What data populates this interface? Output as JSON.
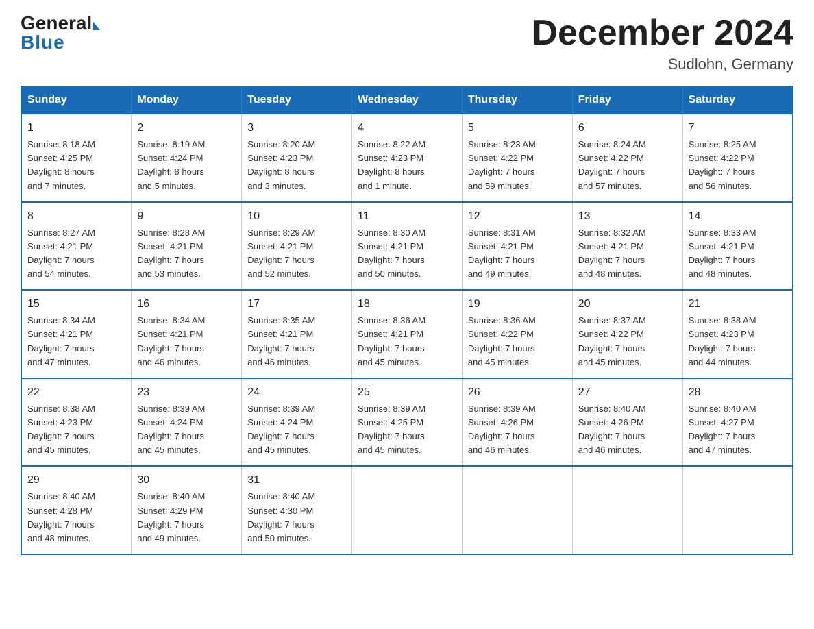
{
  "logo": {
    "general": "General",
    "blue": "Blue",
    "tagline": "Blue"
  },
  "title": "December 2024",
  "subtitle": "Sudlohn, Germany",
  "headers": [
    "Sunday",
    "Monday",
    "Tuesday",
    "Wednesday",
    "Thursday",
    "Friday",
    "Saturday"
  ],
  "weeks": [
    [
      {
        "day": "1",
        "info": "Sunrise: 8:18 AM\nSunset: 4:25 PM\nDaylight: 8 hours\nand 7 minutes."
      },
      {
        "day": "2",
        "info": "Sunrise: 8:19 AM\nSunset: 4:24 PM\nDaylight: 8 hours\nand 5 minutes."
      },
      {
        "day": "3",
        "info": "Sunrise: 8:20 AM\nSunset: 4:23 PM\nDaylight: 8 hours\nand 3 minutes."
      },
      {
        "day": "4",
        "info": "Sunrise: 8:22 AM\nSunset: 4:23 PM\nDaylight: 8 hours\nand 1 minute."
      },
      {
        "day": "5",
        "info": "Sunrise: 8:23 AM\nSunset: 4:22 PM\nDaylight: 7 hours\nand 59 minutes."
      },
      {
        "day": "6",
        "info": "Sunrise: 8:24 AM\nSunset: 4:22 PM\nDaylight: 7 hours\nand 57 minutes."
      },
      {
        "day": "7",
        "info": "Sunrise: 8:25 AM\nSunset: 4:22 PM\nDaylight: 7 hours\nand 56 minutes."
      }
    ],
    [
      {
        "day": "8",
        "info": "Sunrise: 8:27 AM\nSunset: 4:21 PM\nDaylight: 7 hours\nand 54 minutes."
      },
      {
        "day": "9",
        "info": "Sunrise: 8:28 AM\nSunset: 4:21 PM\nDaylight: 7 hours\nand 53 minutes."
      },
      {
        "day": "10",
        "info": "Sunrise: 8:29 AM\nSunset: 4:21 PM\nDaylight: 7 hours\nand 52 minutes."
      },
      {
        "day": "11",
        "info": "Sunrise: 8:30 AM\nSunset: 4:21 PM\nDaylight: 7 hours\nand 50 minutes."
      },
      {
        "day": "12",
        "info": "Sunrise: 8:31 AM\nSunset: 4:21 PM\nDaylight: 7 hours\nand 49 minutes."
      },
      {
        "day": "13",
        "info": "Sunrise: 8:32 AM\nSunset: 4:21 PM\nDaylight: 7 hours\nand 48 minutes."
      },
      {
        "day": "14",
        "info": "Sunrise: 8:33 AM\nSunset: 4:21 PM\nDaylight: 7 hours\nand 48 minutes."
      }
    ],
    [
      {
        "day": "15",
        "info": "Sunrise: 8:34 AM\nSunset: 4:21 PM\nDaylight: 7 hours\nand 47 minutes."
      },
      {
        "day": "16",
        "info": "Sunrise: 8:34 AM\nSunset: 4:21 PM\nDaylight: 7 hours\nand 46 minutes."
      },
      {
        "day": "17",
        "info": "Sunrise: 8:35 AM\nSunset: 4:21 PM\nDaylight: 7 hours\nand 46 minutes."
      },
      {
        "day": "18",
        "info": "Sunrise: 8:36 AM\nSunset: 4:21 PM\nDaylight: 7 hours\nand 45 minutes."
      },
      {
        "day": "19",
        "info": "Sunrise: 8:36 AM\nSunset: 4:22 PM\nDaylight: 7 hours\nand 45 minutes."
      },
      {
        "day": "20",
        "info": "Sunrise: 8:37 AM\nSunset: 4:22 PM\nDaylight: 7 hours\nand 45 minutes."
      },
      {
        "day": "21",
        "info": "Sunrise: 8:38 AM\nSunset: 4:23 PM\nDaylight: 7 hours\nand 44 minutes."
      }
    ],
    [
      {
        "day": "22",
        "info": "Sunrise: 8:38 AM\nSunset: 4:23 PM\nDaylight: 7 hours\nand 45 minutes."
      },
      {
        "day": "23",
        "info": "Sunrise: 8:39 AM\nSunset: 4:24 PM\nDaylight: 7 hours\nand 45 minutes."
      },
      {
        "day": "24",
        "info": "Sunrise: 8:39 AM\nSunset: 4:24 PM\nDaylight: 7 hours\nand 45 minutes."
      },
      {
        "day": "25",
        "info": "Sunrise: 8:39 AM\nSunset: 4:25 PM\nDaylight: 7 hours\nand 45 minutes."
      },
      {
        "day": "26",
        "info": "Sunrise: 8:39 AM\nSunset: 4:26 PM\nDaylight: 7 hours\nand 46 minutes."
      },
      {
        "day": "27",
        "info": "Sunrise: 8:40 AM\nSunset: 4:26 PM\nDaylight: 7 hours\nand 46 minutes."
      },
      {
        "day": "28",
        "info": "Sunrise: 8:40 AM\nSunset: 4:27 PM\nDaylight: 7 hours\nand 47 minutes."
      }
    ],
    [
      {
        "day": "29",
        "info": "Sunrise: 8:40 AM\nSunset: 4:28 PM\nDaylight: 7 hours\nand 48 minutes."
      },
      {
        "day": "30",
        "info": "Sunrise: 8:40 AM\nSunset: 4:29 PM\nDaylight: 7 hours\nand 49 minutes."
      },
      {
        "day": "31",
        "info": "Sunrise: 8:40 AM\nSunset: 4:30 PM\nDaylight: 7 hours\nand 50 minutes."
      },
      {
        "day": "",
        "info": ""
      },
      {
        "day": "",
        "info": ""
      },
      {
        "day": "",
        "info": ""
      },
      {
        "day": "",
        "info": ""
      }
    ]
  ]
}
